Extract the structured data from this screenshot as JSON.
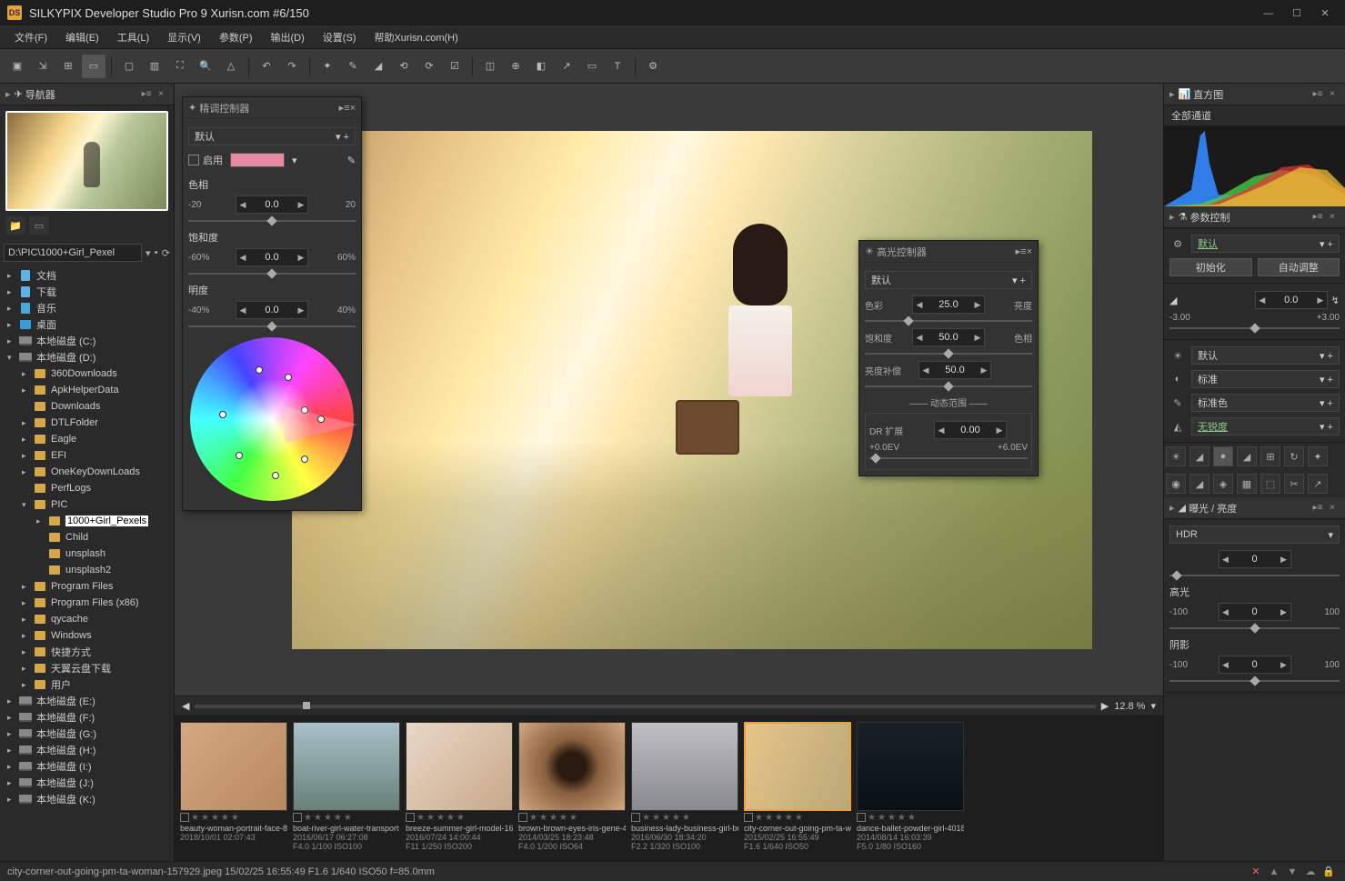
{
  "titlebar": {
    "title": "SILKYPIX Developer Studio Pro 9 Xurisn.com   #6/150"
  },
  "menu": [
    "文件(F)",
    "编辑(E)",
    "工具(L)",
    "显示(V)",
    "参数(P)",
    "输出(D)",
    "设置(S)",
    "帮助Xurisn.com(H)"
  ],
  "navigator": {
    "title": "导航器"
  },
  "pathbar": {
    "value": "D:\\PIC\\1000+Girl_Pexel"
  },
  "tree": [
    {
      "d": 0,
      "exp": "▸",
      "ico": "doc",
      "lbl": "文档"
    },
    {
      "d": 0,
      "exp": "▸",
      "ico": "doc",
      "lbl": "下载"
    },
    {
      "d": 0,
      "exp": "▸",
      "ico": "music",
      "lbl": "音乐"
    },
    {
      "d": 0,
      "exp": "▸",
      "ico": "desk",
      "lbl": "桌面"
    },
    {
      "d": 0,
      "exp": "▸",
      "ico": "drive",
      "lbl": "本地磁盘 (C:)"
    },
    {
      "d": 0,
      "exp": "▾",
      "ico": "drive",
      "lbl": "本地磁盘 (D:)"
    },
    {
      "d": 1,
      "exp": "▸",
      "ico": "folder",
      "lbl": "360Downloads"
    },
    {
      "d": 1,
      "exp": "▸",
      "ico": "folder",
      "lbl": "ApkHelperData"
    },
    {
      "d": 1,
      "exp": "",
      "ico": "folder",
      "lbl": "Downloads"
    },
    {
      "d": 1,
      "exp": "▸",
      "ico": "folder",
      "lbl": "DTLFolder"
    },
    {
      "d": 1,
      "exp": "▸",
      "ico": "folder",
      "lbl": "Eagle"
    },
    {
      "d": 1,
      "exp": "▸",
      "ico": "folder",
      "lbl": "EFI"
    },
    {
      "d": 1,
      "exp": "▸",
      "ico": "folder",
      "lbl": "OneKeyDownLoads"
    },
    {
      "d": 1,
      "exp": "",
      "ico": "folder",
      "lbl": "PerfLogs"
    },
    {
      "d": 1,
      "exp": "▾",
      "ico": "folder",
      "lbl": "PIC"
    },
    {
      "d": 2,
      "exp": "▸",
      "ico": "folder",
      "lbl": "1000+Girl_Pexels",
      "sel": true
    },
    {
      "d": 2,
      "exp": "",
      "ico": "folder",
      "lbl": "Child"
    },
    {
      "d": 2,
      "exp": "",
      "ico": "folder",
      "lbl": "unsplash"
    },
    {
      "d": 2,
      "exp": "",
      "ico": "folder",
      "lbl": "unsplash2"
    },
    {
      "d": 1,
      "exp": "▸",
      "ico": "folder",
      "lbl": "Program Files"
    },
    {
      "d": 1,
      "exp": "▸",
      "ico": "folder",
      "lbl": "Program Files (x86)"
    },
    {
      "d": 1,
      "exp": "▸",
      "ico": "folder",
      "lbl": "qycache"
    },
    {
      "d": 1,
      "exp": "▸",
      "ico": "folder",
      "lbl": "Windows"
    },
    {
      "d": 1,
      "exp": "▸",
      "ico": "folder",
      "lbl": "快捷方式"
    },
    {
      "d": 1,
      "exp": "▸",
      "ico": "folder",
      "lbl": "天翼云盘下载"
    },
    {
      "d": 1,
      "exp": "▸",
      "ico": "folder",
      "lbl": "用户"
    },
    {
      "d": 0,
      "exp": "▸",
      "ico": "drive",
      "lbl": "本地磁盘 (E:)"
    },
    {
      "d": 0,
      "exp": "▸",
      "ico": "drive",
      "lbl": "本地磁盘 (F:)"
    },
    {
      "d": 0,
      "exp": "▸",
      "ico": "drive",
      "lbl": "本地磁盘 (G:)"
    },
    {
      "d": 0,
      "exp": "▸",
      "ico": "drive",
      "lbl": "本地磁盘 (H:)"
    },
    {
      "d": 0,
      "exp": "▸",
      "ico": "drive",
      "lbl": "本地磁盘 (I:)"
    },
    {
      "d": 0,
      "exp": "▸",
      "ico": "drive",
      "lbl": "本地磁盘 (J:)"
    },
    {
      "d": 0,
      "exp": "▸",
      "ico": "drive",
      "lbl": "本地磁盘 (K:)"
    }
  ],
  "zoom": {
    "value": "12.8 %"
  },
  "thumbs": [
    {
      "name": "beauty-woman-portrait-face-8",
      "meta": "2018/10/01 02:07:43",
      "meta2": "",
      "bg": "linear-gradient(135deg,#d4a880,#b88860)"
    },
    {
      "name": "boat-river-girl-water-transport",
      "meta": "2016/06/17 06:27:08",
      "meta2": "F4.0 1/100 ISO100",
      "bg": "linear-gradient(#a8c0c8,#688078)"
    },
    {
      "name": "breeze-summer-girl-model-16",
      "meta": "2016/07/24 14:00:44",
      "meta2": "F11 1/250 ISO200",
      "bg": "linear-gradient(135deg,#e8d8c8,#c8a888)"
    },
    {
      "name": "brown-brown-eyes-iris-gene-4",
      "meta": "2014/03/25 18:23:48",
      "meta2": "F4.0 1/200 ISO64",
      "bg": "radial-gradient(circle at 50% 50%,#2a1a10 20%,#8a6040 40%,#d4a880)"
    },
    {
      "name": "business-lady-business-girl-bu",
      "meta": "2016/06/30 18:34:20",
      "meta2": "F2.2 1/320 ISO100",
      "bg": "linear-gradient(#c0c0c4,#888890)"
    },
    {
      "name": "city-corner-out-going-pm-ta-w",
      "meta": "2015/02/25 16:55:49",
      "meta2": "F1.6 1/640 ISO50",
      "bg": "linear-gradient(115deg,#e8c488,#b8a878)",
      "sel": true
    },
    {
      "name": "dance-ballet-powder-girl-4018",
      "meta": "2014/08/14 16:03:39",
      "meta2": "F5.0 1/80 ISO160",
      "bg": "linear-gradient(#1a2028,#0a1018)"
    }
  ],
  "histogram": {
    "title": "直方图",
    "channel": "全部通道"
  },
  "paramControl": {
    "title": "参数控制",
    "preset": "默认",
    "init": "初始化",
    "auto": "自动调整",
    "ev": {
      "val": "0.0",
      "min": "-3.00",
      "max": "+3.00"
    },
    "wb_preset": "默认",
    "tone_preset": "标准",
    "color_preset": "标准色",
    "nr_preset": "无锐度"
  },
  "exposure": {
    "title": "曝光 / 亮度",
    "mode": "HDR",
    "main": {
      "val": "0"
    },
    "highlight": {
      "label": "高光",
      "val": "0",
      "min": "-100",
      "max": "100"
    },
    "shadow": {
      "label": "阴影",
      "val": "0",
      "min": "-100",
      "max": "100"
    }
  },
  "fineColor": {
    "title": "精调控制器",
    "preset": "默认",
    "enable": "启用",
    "hue": {
      "label": "色相",
      "val": "0.0",
      "min": "-20",
      "max": "20"
    },
    "sat": {
      "label": "饱和度",
      "val": "0.0",
      "min": "-60%",
      "max": "60%"
    },
    "lum": {
      "label": "明度",
      "val": "0.0",
      "min": "-40%",
      "max": "40%"
    }
  },
  "highlight": {
    "title": "高光控制器",
    "preset": "默认",
    "color": {
      "label": "色彩",
      "val": "25.0",
      "rlabel": "亮度"
    },
    "sat": {
      "label": "饱和度",
      "val": "50.0",
      "rlabel": "色相"
    },
    "lum": {
      "label": "亮度补偿",
      "val": "50.0"
    },
    "dr": {
      "label": "动态范围",
      "sublabel": "DR 扩展",
      "val": "0.00",
      "min": "+0.0EV",
      "max": "+6.0EV"
    }
  },
  "status": {
    "text": "city-corner-out-going-pm-ta-woman-157929.jpeg 15/02/25 16:55:49 F1.6 1/640 ISO50 f=85.0mm"
  }
}
